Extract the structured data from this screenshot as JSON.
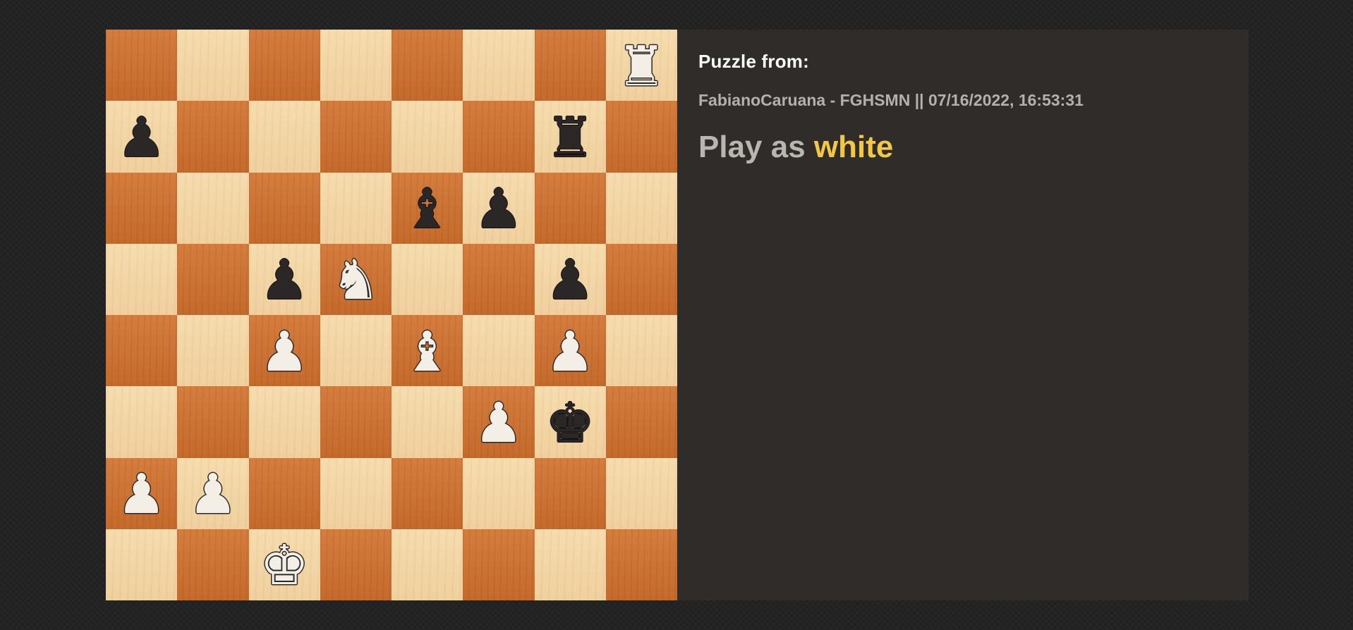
{
  "panel": {
    "title": "Puzzle from:",
    "game_info": "FabianoCaruana - FGHSMN || 07/16/2022, 16:53:31",
    "play_as_prefix": "Play as",
    "play_as_color": "white",
    "highlight_color": "#f2c744"
  },
  "board": {
    "light_square_color": "#f0d09e",
    "dark_square_color": "#c46a2c",
    "pieces": [
      {
        "square": "h8",
        "piece": "rook",
        "color": "white"
      },
      {
        "square": "a7",
        "piece": "pawn",
        "color": "black"
      },
      {
        "square": "g7",
        "piece": "rook",
        "color": "black"
      },
      {
        "square": "e6",
        "piece": "bishop",
        "color": "black"
      },
      {
        "square": "f6",
        "piece": "pawn",
        "color": "black"
      },
      {
        "square": "c5",
        "piece": "pawn",
        "color": "black"
      },
      {
        "square": "d5",
        "piece": "knight",
        "color": "white"
      },
      {
        "square": "g5",
        "piece": "pawn",
        "color": "black"
      },
      {
        "square": "c4",
        "piece": "pawn",
        "color": "white"
      },
      {
        "square": "e4",
        "piece": "bishop",
        "color": "white"
      },
      {
        "square": "g4",
        "piece": "pawn",
        "color": "white"
      },
      {
        "square": "f3",
        "piece": "pawn",
        "color": "white"
      },
      {
        "square": "g3",
        "piece": "king",
        "color": "black"
      },
      {
        "square": "a2",
        "piece": "pawn",
        "color": "white"
      },
      {
        "square": "b2",
        "piece": "pawn",
        "color": "white"
      },
      {
        "square": "c1",
        "piece": "king",
        "color": "white"
      }
    ]
  }
}
